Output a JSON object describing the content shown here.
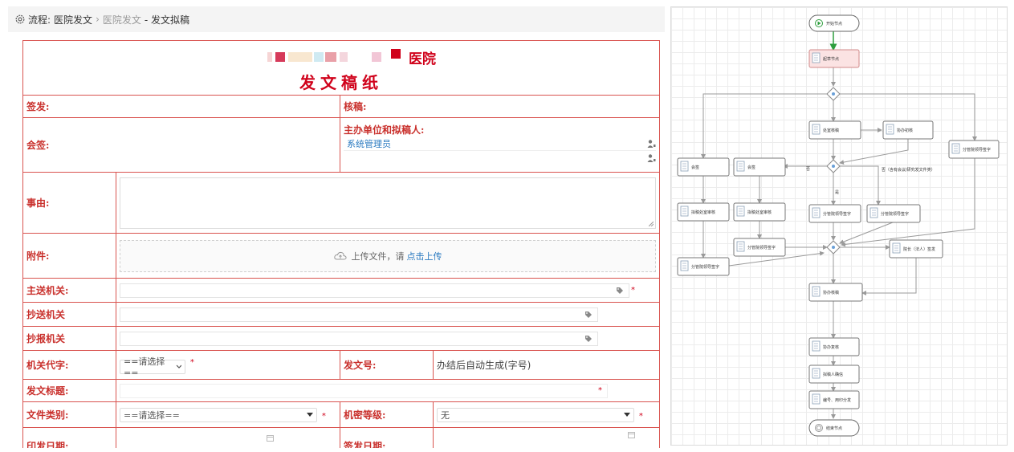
{
  "breadcrumb": {
    "prefix": "流程:",
    "item1": "医院发文",
    "sep": "›",
    "item2": "医院发文",
    "current": "- 发文拟稿"
  },
  "doc": {
    "hospital_suffix": "医院",
    "title": "发文稿纸",
    "labels": {
      "sign": "签发:",
      "review": "核稿:",
      "countersign": "会签:",
      "host_unit": "主办单位和拟稿人:",
      "reason": "事由:",
      "attachment": "附件:",
      "main_send": "主送机关:",
      "cc": "抄送机关",
      "report": "抄报机关",
      "org_code": "机关代字:",
      "doc_no": "发文号:",
      "doc_title": "发文标题:",
      "doc_type": "文件类别:",
      "secret": "机密等级:",
      "print_date": "印发日期:",
      "sign_date": "签发日期:"
    },
    "drafter": "系统管理员",
    "upload_text": "上传文件，请",
    "upload_link": "点击上传",
    "org_code_placeholder": "==请选择==",
    "doc_no_value": "办结后自动生成(字号)",
    "doc_type_placeholder": "==请选择==",
    "secret_value": "无",
    "required_mark": "*"
  },
  "flow": {
    "nodes": {
      "start": "开始节点",
      "draft": "起草节点",
      "office_check": "处室核稿",
      "assist_check": "协办初核",
      "lead_sign_a": "分管院领导签字",
      "counter_a": "会签",
      "counter_b": "会签",
      "office_check_a": "拟稿处室审核",
      "office_check_b": "拟稿处室审核",
      "lead_sign_b": "分管院领导签字",
      "lead_sign_c": "分管院领导签字",
      "lead_sign_d": "分管院领导签字",
      "lead_sign_e": "分管院领导签字",
      "president_sign": "院长（法人）签发",
      "assist_review": "协办核稿",
      "assist_recheck": "协办复核",
      "drafter_confirm": "拟稿人确信",
      "number_print": "编号、用印分发",
      "end": "结束节点"
    },
    "edge_labels": {
      "no": "否",
      "yes": "是",
      "cond": "否（含有会议/研究发文件类）"
    },
    "colors": {
      "start_edge": "#2e9e3e",
      "draft_fill": "#fbe3e3",
      "line": "#9a9a9a"
    }
  }
}
